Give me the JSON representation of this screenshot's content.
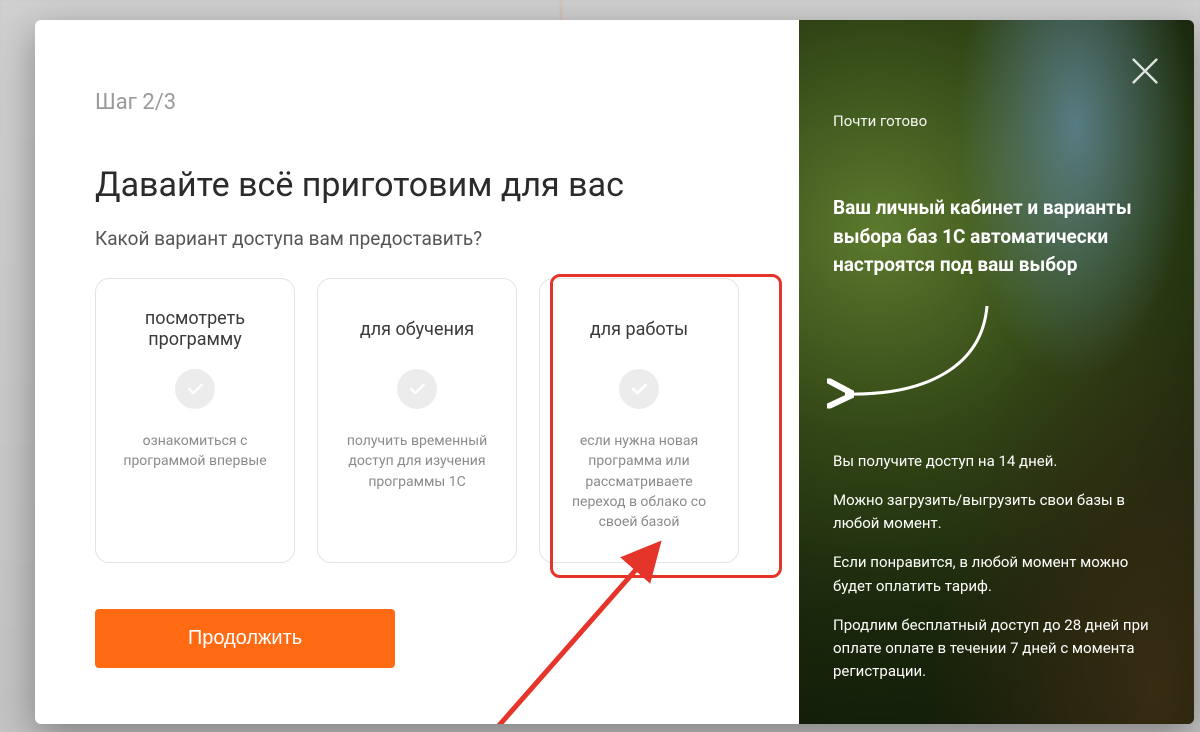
{
  "modal": {
    "step_indicator": "Шаг 2/3",
    "title": "Давайте всё приготовим для вас",
    "subtitle": "Какой вариант доступа вам предоставить?",
    "cards": [
      {
        "title": "посмотреть программу",
        "desc": "ознакомиться с программой впервые"
      },
      {
        "title": "для обучения",
        "desc": "получить временный доступ для изучения программы 1С"
      },
      {
        "title": "для работы",
        "desc": "если нужна новая программа или рассматриваете переход в облако со своей базой"
      }
    ],
    "continue_label": "Продолжить"
  },
  "side": {
    "pretitle": "Почти готово",
    "title": "Ваш личный кабинет и варианты выбора баз 1С автоматически настроятся под ваш выбор",
    "bullets": [
      "Вы получите доступ на 14 дней.",
      "Можно загрузить/выгрузить свои базы в любой момент.",
      "Если понравится, в любой момент можно будет оплатить тариф.",
      "Продлим бесплатный доступ до 28 дней при оплате оплате в течении 7 дней с момента регистрации."
    ]
  }
}
